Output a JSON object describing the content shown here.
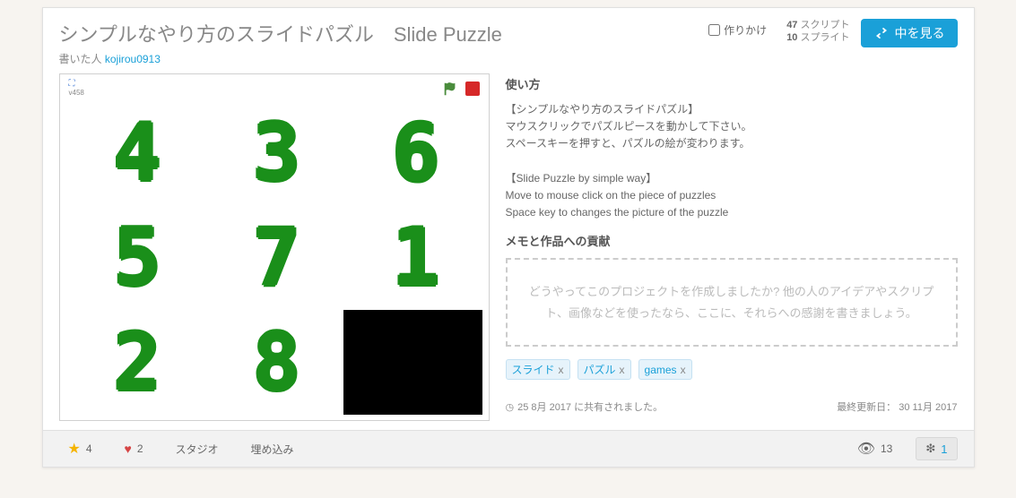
{
  "header": {
    "title": "シンプルなやり方のスライドパズル　Slide Puzzle",
    "author_prefix": "書いた人",
    "author_name": "kojirou0913",
    "draft_label": "作りかけ",
    "counts": {
      "scripts_n": "47",
      "scripts_label": "スクリプト",
      "sprites_n": "10",
      "sprites_label": "スプライト"
    },
    "view_label": "中を見る"
  },
  "stage": {
    "version": "v458",
    "tiles": [
      "4",
      "3",
      "6",
      "5",
      "7",
      "1",
      "2",
      "8",
      ""
    ]
  },
  "info": {
    "howto_title": "使い方",
    "howto_body": "【シンプルなやり方のスライドパズル】\nマウスクリックでパズルピースを動かして下さい。\nスペースキーを押すと、パズルの絵が変わります。\n\n【Slide Puzzle by simple way】\nMove to mouse click on the piece of puzzles\nSpace key to changes the picture of the puzzle",
    "notes_title": "メモと作品への貢献",
    "notes_placeholder": "どうやってこのプロジェクトを作成しましたか? 他の人のアイデアやスクリプト、画像などを使ったなら、ここに、それらへの感謝を書きましょう。",
    "tags": [
      "スライド",
      "パズル",
      "games"
    ],
    "shared_date": "25 8月 2017 に共有されました。",
    "updated_label": "最終更新日：",
    "updated_date": "30 11月 2017"
  },
  "footer": {
    "fav_count": "4",
    "love_count": "2",
    "studio_label": "スタジオ",
    "embed_label": "埋め込み",
    "view_count": "13",
    "remix_count": "1"
  }
}
